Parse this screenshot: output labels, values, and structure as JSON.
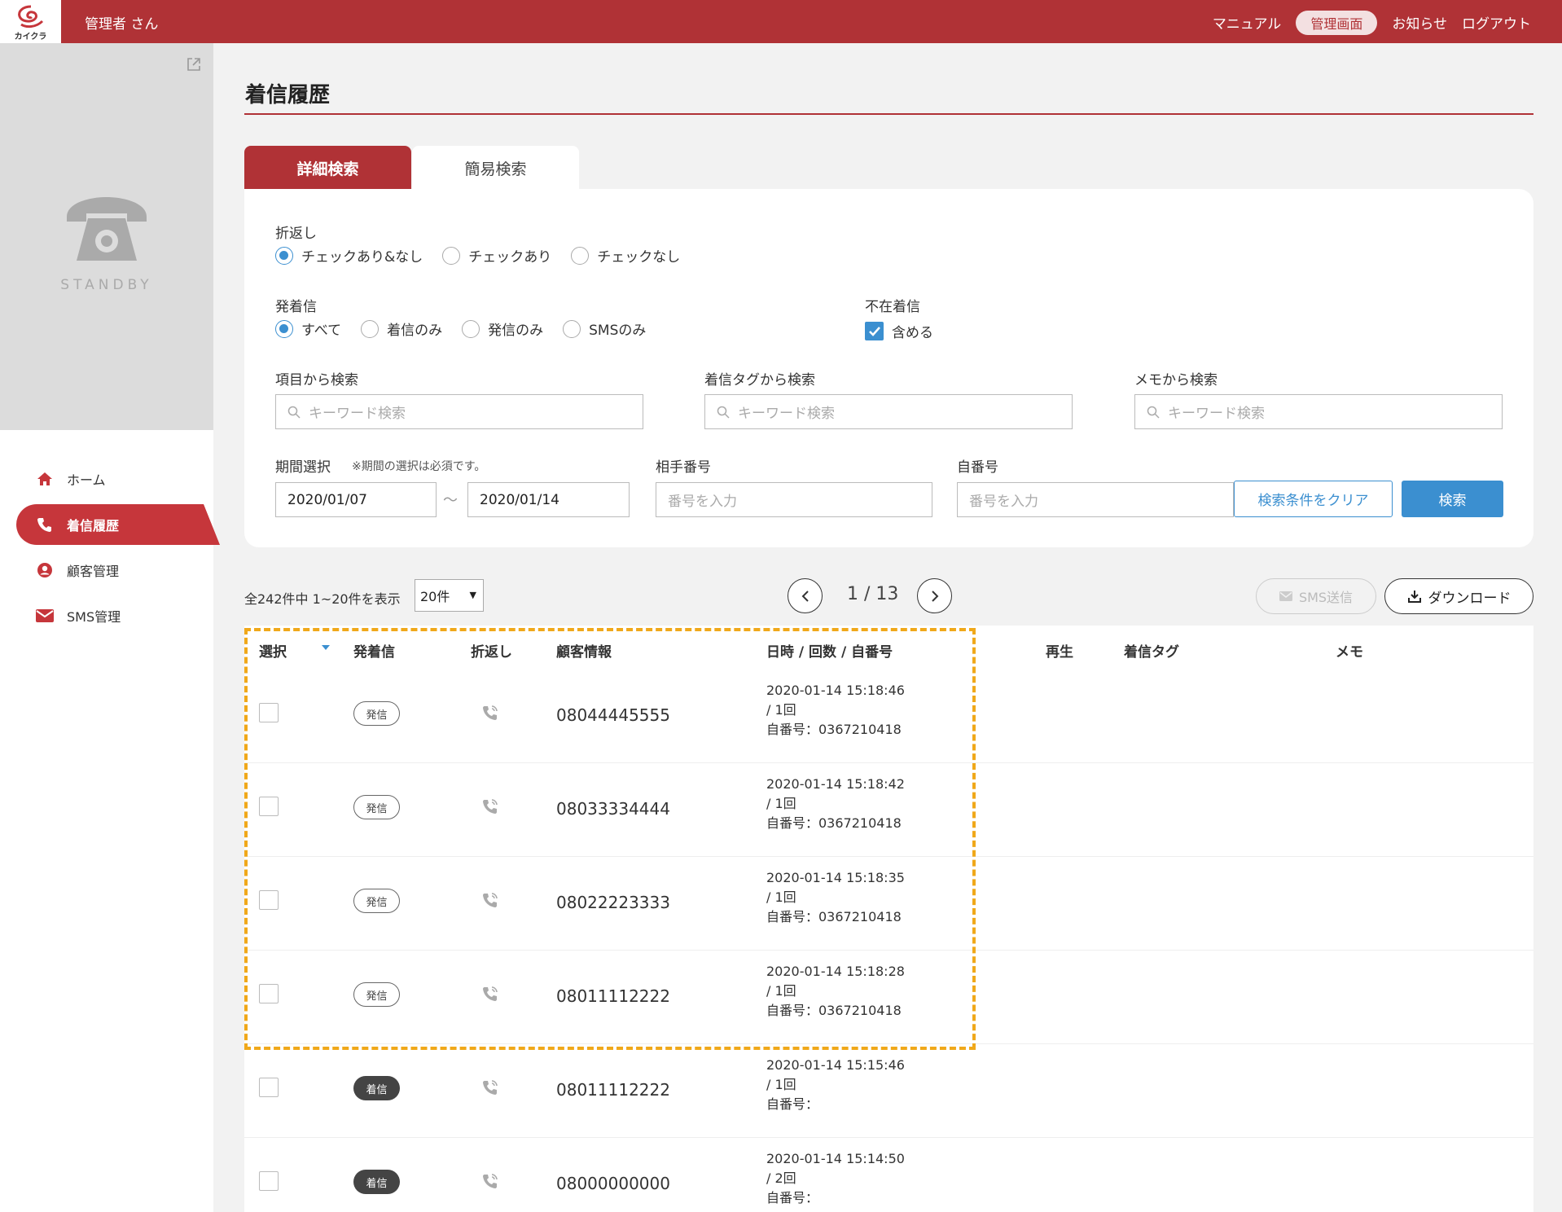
{
  "header": {
    "logo_text": "カイクラ",
    "username": "管理者 さん",
    "nav": {
      "manual": "マニュアル",
      "admin": "管理画面",
      "news": "お知らせ",
      "logout": "ログアウト"
    }
  },
  "sidebar": {
    "standby_label": "STANDBY",
    "items": [
      {
        "label": "ホーム",
        "icon": "home-icon"
      },
      {
        "label": "着信履歴",
        "icon": "phone-icon"
      },
      {
        "label": "顧客管理",
        "icon": "user-circle-icon"
      },
      {
        "label": "SMS管理",
        "icon": "mail-icon"
      }
    ]
  },
  "page": {
    "title": "着信履歴"
  },
  "tabs": {
    "detail": "詳細検索",
    "simple": "簡易検索"
  },
  "search": {
    "callback": {
      "label": "折返し",
      "options": [
        "チェックあり&なし",
        "チェックあり",
        "チェックなし"
      ],
      "selected": 0
    },
    "direction": {
      "label": "発着信",
      "options": [
        "すべて",
        "着信のみ",
        "発信のみ",
        "SMSのみ"
      ],
      "selected": 0
    },
    "missed": {
      "label": "不在着信",
      "checkbox_label": "含める",
      "checked": true
    },
    "item_search": {
      "label": "項目から検索",
      "placeholder": "キーワード検索"
    },
    "tag_search": {
      "label": "着信タグから検索",
      "placeholder": "キーワード検索"
    },
    "memo_search": {
      "label": "メモから検索",
      "placeholder": "キーワード検索"
    },
    "period": {
      "label": "期間選択",
      "note": "※期間の選択は必須です。",
      "from": "2020/01/07",
      "to": "2020/01/14",
      "separator": "～"
    },
    "partner": {
      "label": "相手番号",
      "placeholder": "番号を入力"
    },
    "own": {
      "label": "自番号",
      "placeholder": "番号を入力"
    },
    "clear_button": "検索条件をクリア",
    "search_button": "検索"
  },
  "results": {
    "summary": "全242件中 1~20件を表示",
    "per_page": "20件",
    "pager": "1 / 13",
    "sms_button": "SMS送信",
    "download_button": "ダウンロード"
  },
  "table": {
    "headers": {
      "select": "選択",
      "direction": "発着信",
      "callback": "折返し",
      "customer": "顧客情報",
      "datetime": "日時 / 回数 / 自番号",
      "play": "再生",
      "tag": "着信タグ",
      "memo": "メモ"
    },
    "rows": [
      {
        "badge": "発信",
        "type": "out",
        "number": "08044445555",
        "datetime": "2020-01-14 15:18:46",
        "count": "/ 1回",
        "own": "自番号：0367210418"
      },
      {
        "badge": "発信",
        "type": "out",
        "number": "08033334444",
        "datetime": "2020-01-14 15:18:42",
        "count": "/ 1回",
        "own": "自番号：0367210418"
      },
      {
        "badge": "発信",
        "type": "out",
        "number": "08022223333",
        "datetime": "2020-01-14 15:18:35",
        "count": "/ 1回",
        "own": "自番号：0367210418"
      },
      {
        "badge": "発信",
        "type": "out",
        "number": "08011112222",
        "datetime": "2020-01-14 15:18:28",
        "count": "/ 1回",
        "own": "自番号：0367210418"
      },
      {
        "badge": "着信",
        "type": "in",
        "number": "08011112222",
        "datetime": "2020-01-14 15:15:46",
        "count": "/ 1回",
        "own": "自番号："
      },
      {
        "badge": "着信",
        "type": "in",
        "number": "08000000000",
        "datetime": "2020-01-14 15:14:50",
        "count": "/ 2回",
        "own": "自番号："
      }
    ]
  },
  "colors": {
    "brand": "#b03236",
    "accent": "#3b8fd0",
    "highlight": "#f0a81a"
  }
}
